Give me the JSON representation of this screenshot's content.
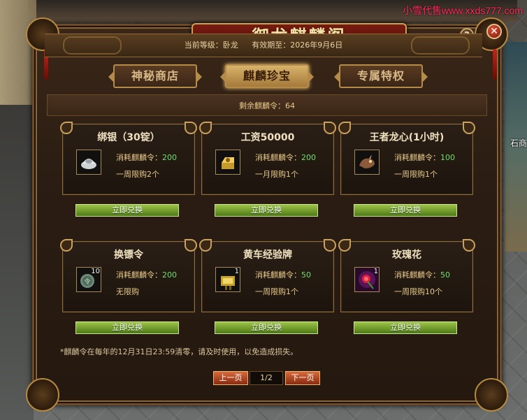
{
  "watermark": "小雪代售www.xxds777.com",
  "world_label": "石商",
  "window": {
    "title": "御龙麒麟阁",
    "help_label": "?",
    "close_label": "✕"
  },
  "info": {
    "level_text": "当前等级：卧龙",
    "expiry_text": "有效期至：2026年9月6日"
  },
  "tabs": [
    {
      "label": "神秘商店",
      "active": false
    },
    {
      "label": "麒麟珍宝",
      "active": true
    },
    {
      "label": "专属特权",
      "active": false
    }
  ],
  "remaining_text": "剩余麒麟令：64",
  "items": [
    {
      "title": "绑银（30锭）",
      "icon": "silver-ingot-icon",
      "qty": "",
      "cost_label": "消耗麒麟令：",
      "cost": "200",
      "limit": "一周限购2个",
      "button": "立即兑换"
    },
    {
      "title": "工资50000",
      "icon": "salary-icon",
      "qty": "",
      "cost_label": "消耗麒麟令：",
      "cost": "200",
      "limit": "一月限购1个",
      "button": "立即兑换"
    },
    {
      "title": "王者龙心(1小时)",
      "icon": "dragon-heart-icon",
      "qty": "",
      "cost_label": "消耗麒麟令：",
      "cost": "100",
      "limit": "一周限购1个",
      "button": "立即兑换"
    },
    {
      "title": "换镖令",
      "icon": "escort-token-icon",
      "qty": "10",
      "cost_label": "消耗麒麟令：",
      "cost": "200",
      "limit": "无限购",
      "button": "立即兑换"
    },
    {
      "title": "黄车经验牌",
      "icon": "exp-plaque-icon",
      "qty": "1",
      "cost_label": "消耗麒麟令：",
      "cost": "50",
      "limit": "一周限购1个",
      "button": "立即兑换"
    },
    {
      "title": "玫瑰花",
      "icon": "rose-icon",
      "qty": "1",
      "cost_label": "消耗麒麟令：",
      "cost": "50",
      "limit": "一周限购10个",
      "button": "立即兑换"
    }
  ],
  "footer_note": "*麒麟令在每年的12月31日23:59清零，请及时使用，以免造成损失。",
  "pager": {
    "prev_label": "上一页",
    "page_text": "1/2",
    "next_label": "下一页"
  }
}
